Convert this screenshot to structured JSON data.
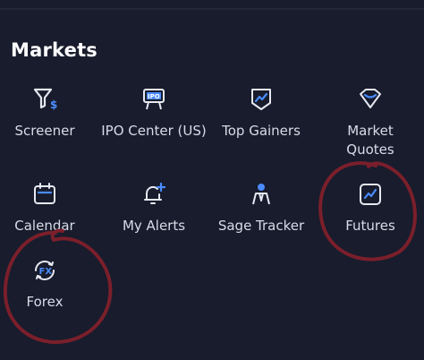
{
  "section": {
    "title": "Markets"
  },
  "tiles": [
    {
      "label": "Screener",
      "icon": "funnel-dollar-icon"
    },
    {
      "label": "IPO Center (US)",
      "icon": "ipo-sign-icon"
    },
    {
      "label": "Top Gainers",
      "icon": "trend-shield-icon"
    },
    {
      "label": "Market\nQuotes",
      "icon": "diamond-icon"
    },
    {
      "label": "Calendar",
      "icon": "calendar-icon"
    },
    {
      "label": "My Alerts",
      "icon": "bell-plus-icon"
    },
    {
      "label": "Sage Tracker",
      "icon": "person-tie-icon"
    },
    {
      "label": "Futures",
      "icon": "chart-square-icon"
    },
    {
      "label": "Forex",
      "icon": "fx-icon"
    }
  ],
  "colors": {
    "background": "#181c2c",
    "icon_accent": "#4a8cff",
    "icon_outline": "#e6e9f2",
    "annotation": "#7a1f2b"
  }
}
